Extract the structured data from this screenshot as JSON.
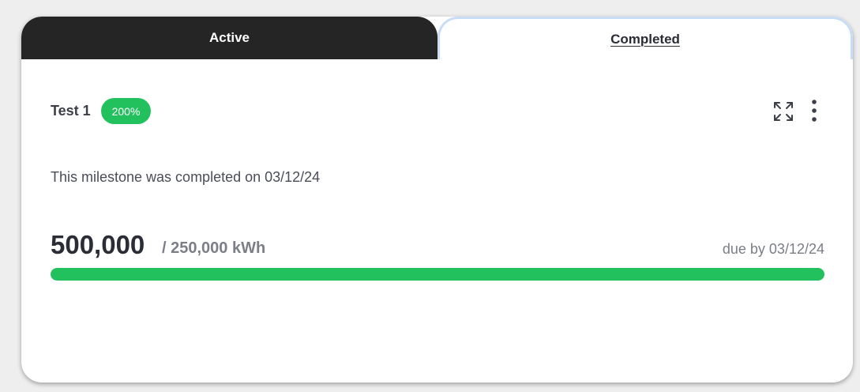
{
  "tabs": {
    "active_label": "Active",
    "completed_label": "Completed",
    "selected": "Completed"
  },
  "milestone": {
    "title": "Test 1",
    "badge": "200%",
    "completed_message": "This milestone was completed on 03/12/24",
    "current_value": "500,000",
    "target_value": "/ 250,000 kWh",
    "due_text": "due by 03/12/24",
    "progress_fraction": 1.0
  },
  "icons": {
    "expand": "expand-icon",
    "more": "more-vertical-icon"
  },
  "colors": {
    "success": "#22c15e",
    "tab_active_bg": "#252525",
    "tab_selected_border": "#c9dcf7"
  }
}
